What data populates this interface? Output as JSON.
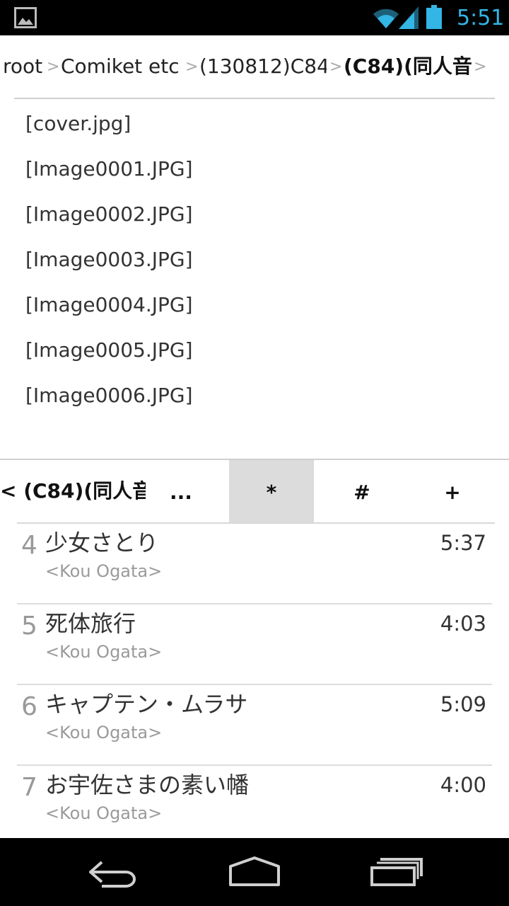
{
  "status_bar": {
    "time": "5:51",
    "notification_icon": "gallery-icon",
    "icons": [
      "wifi-icon",
      "signal-icon",
      "battery-icon"
    ],
    "accent_color": "#33b5e5"
  },
  "breadcrumb": {
    "items": [
      "root",
      "Comiket etc",
      "(130812)C84",
      "(C84)(同人音"
    ],
    "separator": ">"
  },
  "files": [
    "[cover.jpg]",
    "[Image0001.JPG]",
    "[Image0002.JPG]",
    "[Image0003.JPG]",
    "[Image0004.JPG]",
    "[Image0005.JPG]",
    "[Image0006.JPG]"
  ],
  "toolbar": {
    "back_label": "< (C84)(同人音",
    "more_label": "...",
    "star_label": "*",
    "hash_label": "#",
    "plus_label": "+"
  },
  "tracks": [
    {
      "number": "4",
      "title": "少女さとり",
      "artist": "<Kou Ogata>",
      "duration": "5:37"
    },
    {
      "number": "5",
      "title": "死体旅行",
      "artist": "<Kou Ogata>",
      "duration": "4:03"
    },
    {
      "number": "6",
      "title": "キャプテン・ムラサ",
      "artist": "<Kou Ogata>",
      "duration": "5:09"
    },
    {
      "number": "7",
      "title": "お宇佐さまの素い幡",
      "artist": "<Kou Ogata>",
      "duration": "4:00"
    }
  ],
  "nav_bar": {
    "icons": [
      "back-icon",
      "home-icon",
      "recent-apps-icon"
    ]
  }
}
